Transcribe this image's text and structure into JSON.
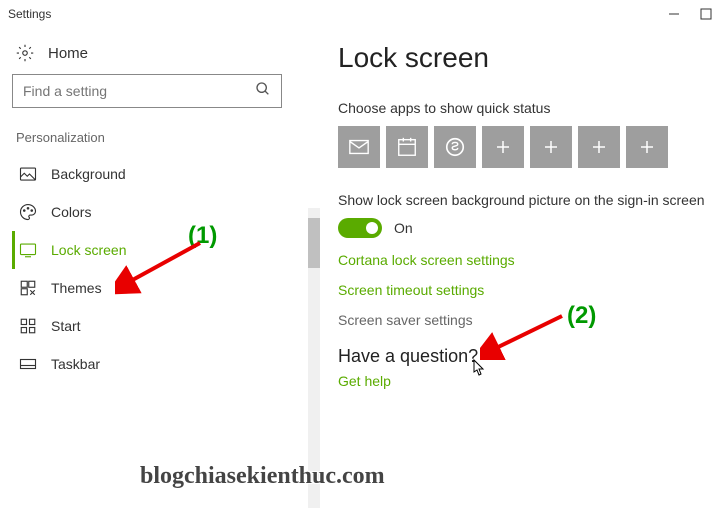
{
  "titlebar": {
    "title": "Settings"
  },
  "sidebar": {
    "home": "Home",
    "search_placeholder": "Find a setting",
    "section": "Personalization",
    "items": [
      {
        "label": "Background"
      },
      {
        "label": "Colors"
      },
      {
        "label": "Lock screen"
      },
      {
        "label": "Themes"
      },
      {
        "label": "Start"
      },
      {
        "label": "Taskbar"
      }
    ]
  },
  "main": {
    "title": "Lock screen",
    "choose_apps": "Choose apps to show quick status",
    "show_bg_label": "Show lock screen background picture on the sign-in screen",
    "toggle_state": "On",
    "link_cortana": "Cortana lock screen settings",
    "link_timeout": "Screen timeout settings",
    "link_saver": "Screen saver settings",
    "question": "Have a question?",
    "get_help": "Get help"
  },
  "annotations": {
    "num1": "(1)",
    "num2": "(2)",
    "watermark": "blogchiasekienthuc.com"
  }
}
